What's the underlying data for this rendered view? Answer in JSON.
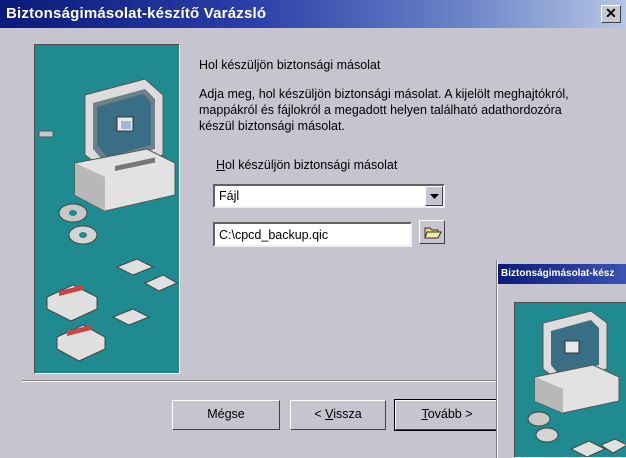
{
  "window": {
    "title": "Biztonságimásolat-készítő Varázsló",
    "close_glyph": "✕"
  },
  "content": {
    "heading": "Hol készüljön biztonsági másolat",
    "description": "Adja meg, hol készüljön biztonsági másolat.  A kijelölt meghajtókról, mappákról és fájlokról a megadott helyen található adathordozóra készül biztonsági másolat.",
    "group_label_mnemonic": "H",
    "group_label_rest": "ol készüljön biztonsági másolat",
    "destination_type": "Fájl",
    "destination_path": "C:\\cpcd_backup.qic"
  },
  "buttons": {
    "cancel": "Mégse",
    "back_prefix": "< ",
    "back_mnemonic": "V",
    "back_rest": "issza",
    "next_mnemonic": "T",
    "next_rest": "ovább >"
  },
  "second_window": {
    "title": "Biztonságimásolat-kész"
  },
  "icons": {
    "panel_art": "computer-with-discs-and-tapes-illustration",
    "combo_arrow": "chevron-down-icon",
    "browse": "folder-open-icon"
  },
  "colors": {
    "titlebar_start": "#0a1a7a",
    "panel_teal": "#1f8a8f",
    "face": "#c6c4cf"
  }
}
